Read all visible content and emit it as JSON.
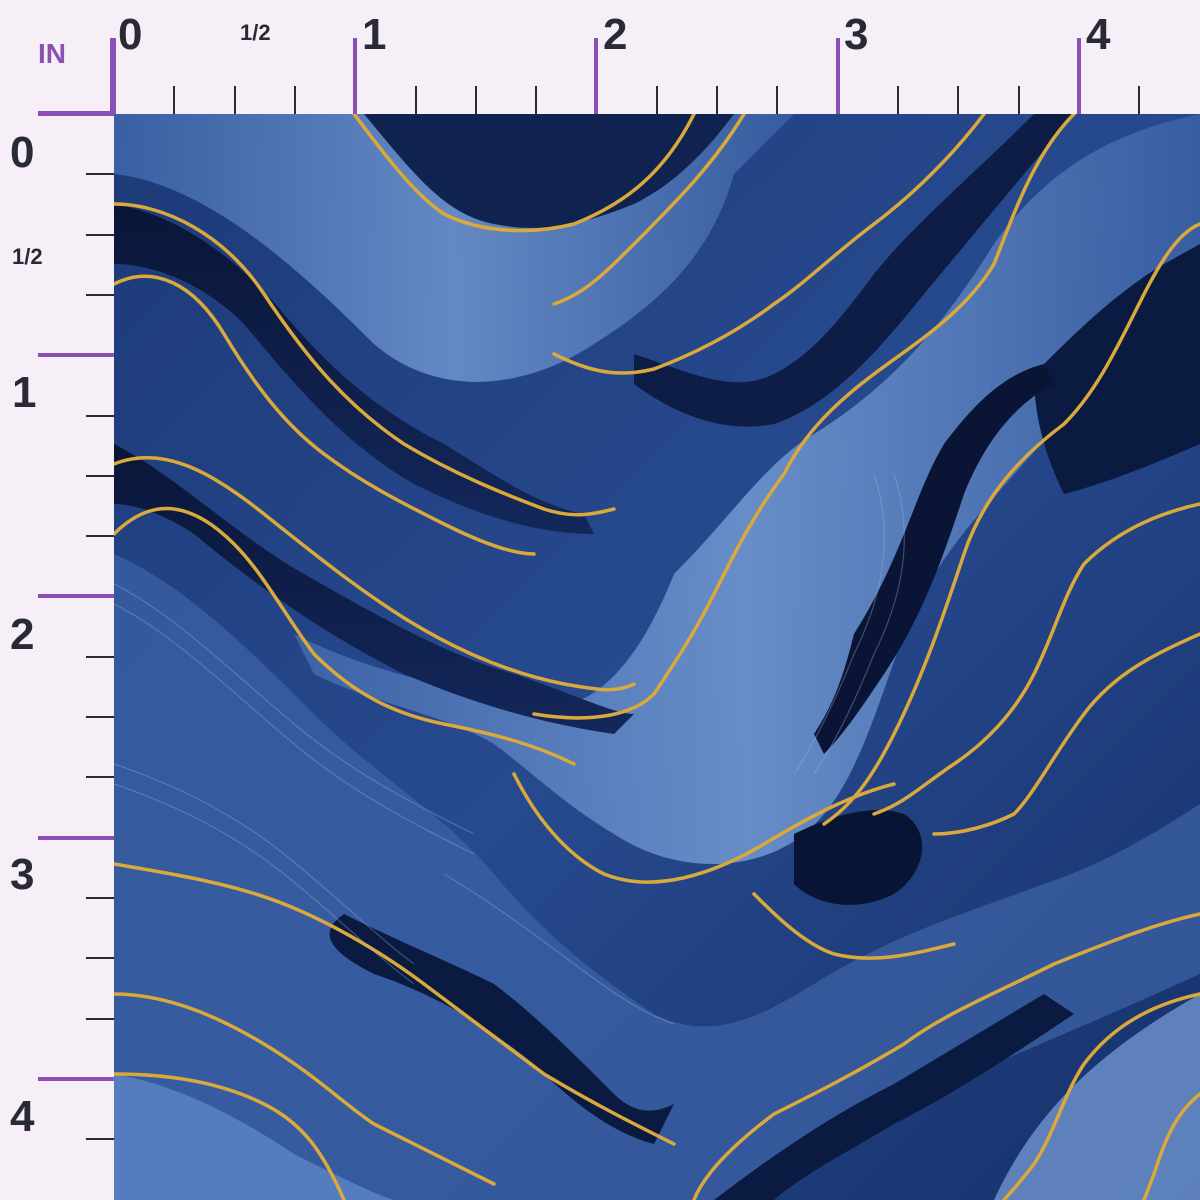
{
  "ruler": {
    "unit_label": "IN",
    "top_labels": [
      "0",
      "1/2",
      "1",
      "2",
      "3",
      "4"
    ],
    "left_labels": [
      "0",
      "1/2",
      "1",
      "2",
      "3",
      "4"
    ]
  },
  "colors": {
    "background": "#f6eff7",
    "accent": "#8c4fb3",
    "text": "#2a2a36",
    "marble_light": "#5f86c4",
    "marble_mid": "#2c4f93",
    "marble_dark": "#0c1a3d",
    "gold": "#d9a93b"
  },
  "swatch": {
    "pattern": "blue-marble-with-gold-veins"
  }
}
